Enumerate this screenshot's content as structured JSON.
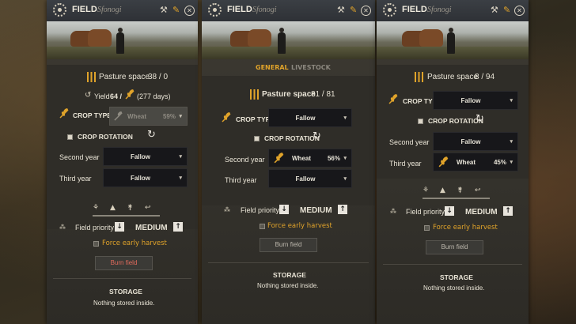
{
  "panels": [
    {
      "title": "FIELD",
      "subtitle": "Sfonogi",
      "pasture": {
        "label": "Pasture space",
        "value": "38 / 0"
      },
      "yield": {
        "label": "Yield",
        "value": "64 /",
        "days": "(277 days)"
      },
      "crop_type": {
        "label": "CROP TYPE",
        "value": "Wheat",
        "percent": "59%"
      },
      "crop_rotation": {
        "label": "CROP ROTATION"
      },
      "second_year": {
        "label": "Second year",
        "value": "Fallow"
      },
      "third_year": {
        "label": "Third year",
        "value": "Fallow"
      },
      "priority": {
        "label": "Field priority",
        "value": "MEDIUM"
      },
      "force_harvest": "Force early harvest",
      "burn_field": "Burn field",
      "storage": {
        "title": "STORAGE",
        "empty": "Nothing stored inside."
      }
    },
    {
      "title": "FIELD",
      "subtitle": "Sfonogi",
      "tabs": {
        "general": "GENERAL",
        "livestock": "LIVESTOCK"
      },
      "pasture": {
        "label": "Pasture space",
        "value": "81 / 81"
      },
      "crop_type": {
        "label": "CROP TYPE",
        "value": "Fallow"
      },
      "crop_rotation": {
        "label": "CROP ROTATION"
      },
      "second_year": {
        "label": "Second year",
        "value": "Wheat",
        "percent": "56%"
      },
      "third_year": {
        "label": "Third year",
        "value": "Fallow"
      },
      "priority": {
        "label": "Field priority",
        "value": "MEDIUM"
      },
      "force_harvest": "Force early harvest",
      "burn_field": "Burn field",
      "storage": {
        "title": "STORAGE",
        "empty": "Nothing stored inside."
      }
    },
    {
      "title": "FIELD",
      "subtitle": "Sfonogi",
      "pasture": {
        "label": "Pasture space",
        "value": "8 / 94"
      },
      "crop_type": {
        "label": "CROP TYPE",
        "value": "Fallow"
      },
      "crop_rotation": {
        "label": "CROP ROTATION"
      },
      "second_year": {
        "label": "Second year",
        "value": "Fallow"
      },
      "third_year": {
        "label": "Third year",
        "value": "Wheat",
        "percent": "45%"
      },
      "priority": {
        "label": "Field priority",
        "value": "MEDIUM"
      },
      "force_harvest": "Force early harvest",
      "burn_field": "Burn field",
      "storage": {
        "title": "STORAGE",
        "empty": "Nothing stored inside."
      }
    }
  ],
  "icons": [
    "gear-icon",
    "hammer-icon",
    "pin-icon",
    "close-icon",
    "pasture-fence-icon",
    "wheat-icon",
    "sickle-icon",
    "rotation-icon",
    "checkbox-icon",
    "arrow-down-icon",
    "arrow-up-icon",
    "workers-icon"
  ],
  "colors": {
    "accent": "#e0a32a",
    "panel": "#34322c",
    "titlebar": "#2e3136",
    "danger": "#e06a5c"
  }
}
